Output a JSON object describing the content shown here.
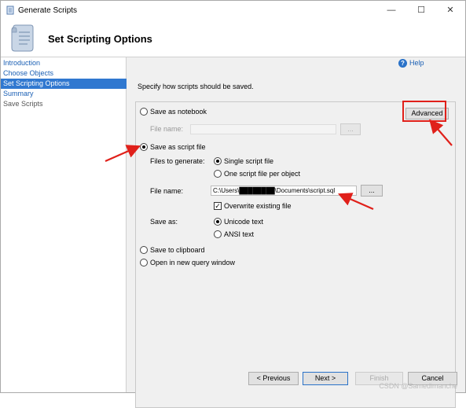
{
  "window": {
    "title": "Generate Scripts",
    "minimize_glyph": "—",
    "maximize_glyph": "☐",
    "close_glyph": "✕"
  },
  "header": {
    "title": "Set Scripting Options"
  },
  "nav": {
    "items": [
      {
        "label": "Introduction",
        "state": "link"
      },
      {
        "label": "Choose Objects",
        "state": "link"
      },
      {
        "label": "Set Scripting Options",
        "state": "active"
      },
      {
        "label": "Summary",
        "state": "link"
      },
      {
        "label": "Save Scripts",
        "state": "disabled"
      }
    ]
  },
  "help": {
    "icon_glyph": "?",
    "label": "Help"
  },
  "description": "Specify how scripts should be saved.",
  "options": {
    "notebook": {
      "label": "Save as notebook",
      "checked": false
    },
    "notebook_file_label": "File name:",
    "notebook_file_value": "",
    "notebook_browse": "...",
    "advanced": "Advanced",
    "script_file": {
      "label": "Save as script file",
      "checked": true
    },
    "files_to_generate_label": "Files to generate:",
    "single_file": {
      "label": "Single script file",
      "checked": true
    },
    "one_per_object": {
      "label": "One script file per object",
      "checked": false
    },
    "file_name_label": "File name:",
    "file_name_value": "C:\\Users\\████████\\Documents\\script.sql",
    "browse": "...",
    "overwrite": {
      "label": "Overwrite existing file",
      "checked": true,
      "glyph": "✓"
    },
    "save_as_label": "Save as:",
    "unicode": {
      "label": "Unicode text",
      "checked": true
    },
    "ansi": {
      "label": "ANSI text",
      "checked": false
    },
    "clipboard": {
      "label": "Save to clipboard",
      "checked": false
    },
    "query_window": {
      "label": "Open in new query window",
      "checked": false
    }
  },
  "footer": {
    "previous": "< Previous",
    "next": "Next >",
    "finish": "Finish",
    "cancel": "Cancel"
  },
  "watermark": "CSDN @Samedimanche",
  "colors": {
    "nav_link": "#1a5fb4",
    "nav_active": "#3078d0",
    "annotation_red": "#e0201a"
  }
}
